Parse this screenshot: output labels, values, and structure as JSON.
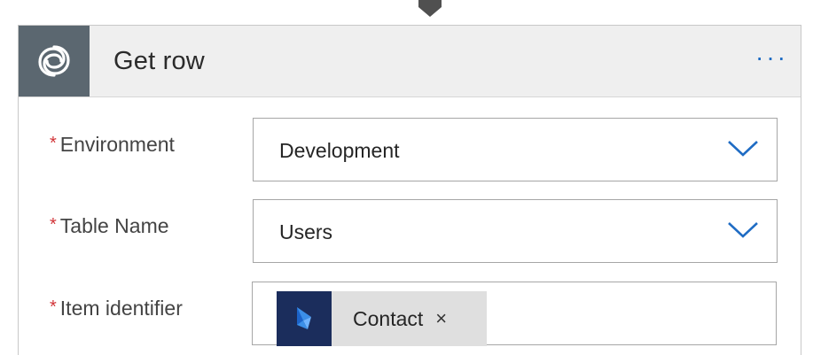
{
  "action": {
    "title": "Get row",
    "menu_label": "···",
    "icon": "dataverse-connector-icon"
  },
  "fields": {
    "required_marker": "*",
    "environment": {
      "label": "Environment",
      "value": "Development"
    },
    "table_name": {
      "label": "Table Name",
      "value": "Users"
    },
    "item_identifier": {
      "label": "Item identifier",
      "token": {
        "label": "Contact",
        "remove_glyph": "×",
        "icon": "dynamics-365-icon"
      }
    }
  },
  "colors": {
    "header_bg": "#efefef",
    "icon_box_bg": "#5b6770",
    "required": "#d13438",
    "accent_blue": "#1f6cc4",
    "token_bg": "#dfdfdf",
    "token_icon_bg": "#1b2d5c"
  }
}
